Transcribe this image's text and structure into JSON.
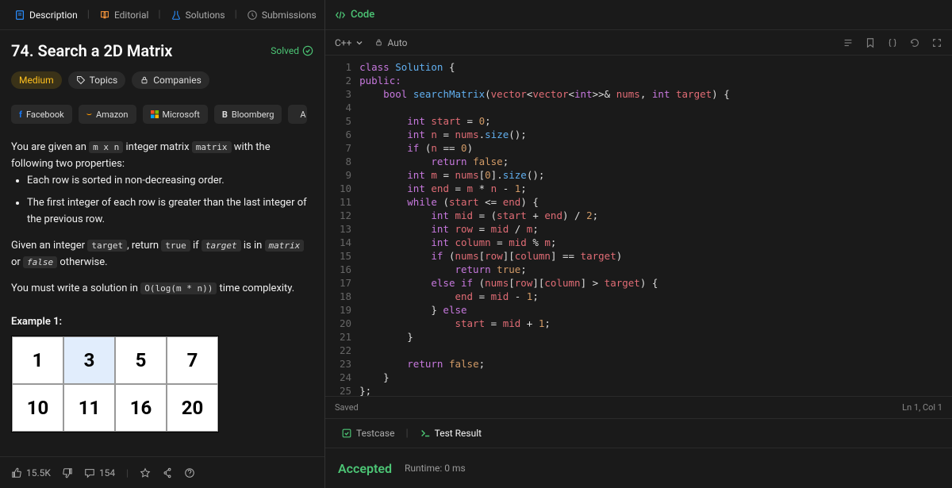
{
  "leftTabs": [
    {
      "label": "Description",
      "icon": "doc",
      "active": true
    },
    {
      "label": "Editorial",
      "icon": "book",
      "active": false
    },
    {
      "label": "Solutions",
      "icon": "flask",
      "active": false
    },
    {
      "label": "Submissions",
      "icon": "clock",
      "active": false
    }
  ],
  "problem": {
    "title": "74. Search a 2D Matrix",
    "solvedLabel": "Solved",
    "difficulty": "Medium",
    "topicsLabel": "Topics",
    "companiesLabel": "Companies",
    "companies": [
      "Facebook",
      "Amazon",
      "Microsoft",
      "Bloomberg",
      "A"
    ],
    "intro": {
      "p1_a": "You are given an ",
      "p1_code1": "m x n",
      "p1_b": " integer matrix ",
      "p1_code2": "matrix",
      "p1_c": " with the following two properties:",
      "li1": "Each row is sorted in non-decreasing order.",
      "li2": "The first integer of each row is greater than the last integer of the previous row.",
      "p2_a": "Given an integer ",
      "p2_code1": "target",
      "p2_b": ", return ",
      "p2_code2": "true",
      "p2_c": " if ",
      "p2_code3": "target",
      "p2_d": " is in ",
      "p2_code4": "matrix",
      "p2_e": " or ",
      "p2_code5": "false",
      "p2_f": " otherwise.",
      "p3_a": "You must write a solution in ",
      "p3_code1": "O(log(m * n))",
      "p3_b": " time complexity."
    },
    "example1Label": "Example 1:",
    "exampleMatrix": [
      [
        "1",
        "3",
        "5",
        "7"
      ],
      [
        "10",
        "11",
        "16",
        "20"
      ]
    ],
    "highlightCell": [
      0,
      1
    ]
  },
  "footer": {
    "likes": "15.5K",
    "comments": "154"
  },
  "code": {
    "title": "Code",
    "language": "C++",
    "auto": "Auto",
    "savedLabel": "Saved",
    "cursor": "Ln 1, Col 1"
  },
  "resultsTabs": {
    "testcase": "Testcase",
    "testResult": "Test Result"
  },
  "result": {
    "accepted": "Accepted",
    "runtime": "Runtime: 0 ms"
  }
}
